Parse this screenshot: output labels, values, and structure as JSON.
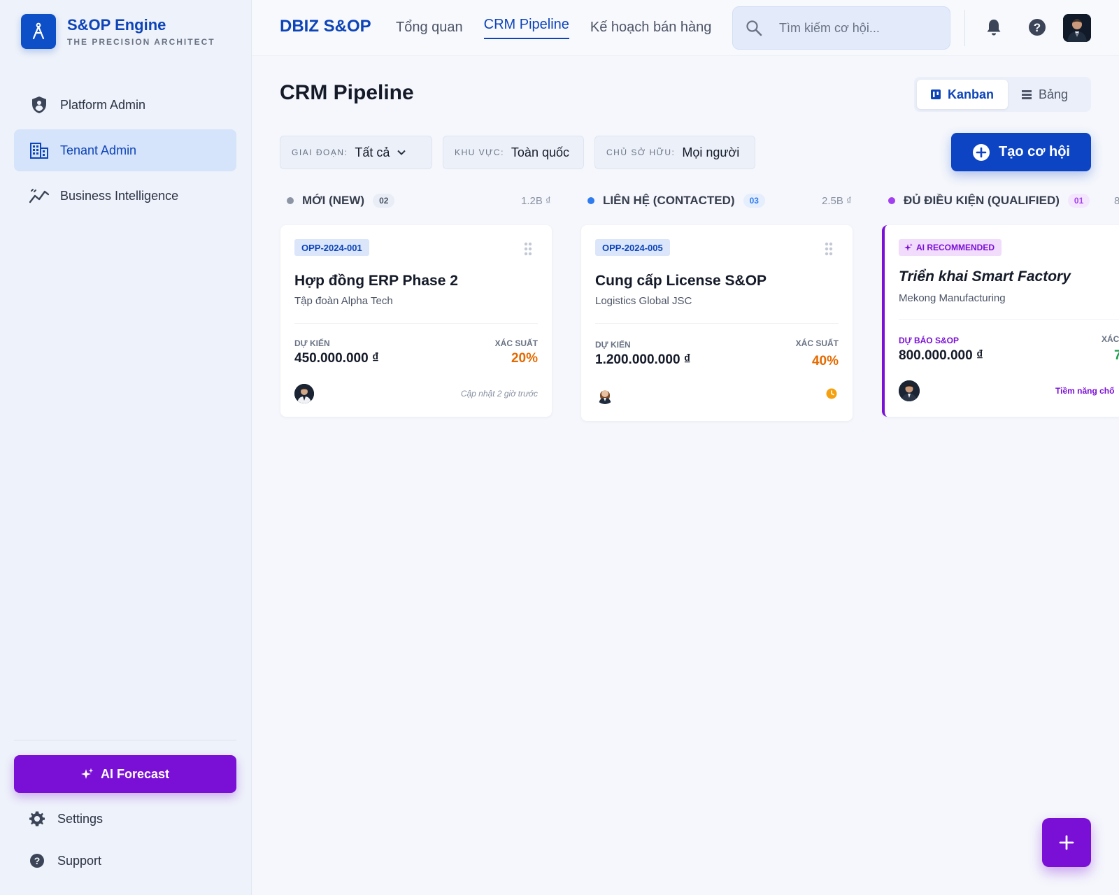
{
  "brand": {
    "title": "S&OP Engine",
    "subtitle": "THE PRECISION ARCHITECT"
  },
  "sidebar": {
    "items": [
      {
        "label": "Platform Admin",
        "icon": "shield-icon",
        "active": false
      },
      {
        "label": "Tenant Admin",
        "icon": "building-icon",
        "active": true
      },
      {
        "label": "Business Intelligence",
        "icon": "analytics-icon",
        "active": false
      }
    ],
    "ai_forecast": "AI Forecast",
    "settings": "Settings",
    "support": "Support"
  },
  "topbar": {
    "app_name": "DBIZ S&OP",
    "tabs": [
      {
        "label": "Tổng quan",
        "active": false
      },
      {
        "label": "CRM Pipeline",
        "active": true
      },
      {
        "label": "Kế hoạch bán hàng",
        "active": false
      }
    ],
    "search_placeholder": "Tìm kiếm cơ hội..."
  },
  "page": {
    "title": "CRM Pipeline",
    "views": {
      "kanban": "Kanban",
      "table": "Bảng",
      "selected": "kanban"
    },
    "filters": [
      {
        "label": "GIAI ĐOẠN:",
        "value": "Tất cả"
      },
      {
        "label": "KHU VỰC:",
        "value": "Toàn quốc"
      },
      {
        "label": "CHỦ SỞ HỮU:",
        "value": "Mọi người"
      }
    ],
    "create_button": "Tạo cơ hội"
  },
  "columns": [
    {
      "title": "MỚI (NEW)",
      "count": "02",
      "total": "1.2B ₫",
      "dot_color": "#8d95a5",
      "card": {
        "tag": "OPP-2024-001",
        "title": "Hợp đồng ERP Phase 2",
        "company": "Tập đoàn Alpha Tech",
        "amount_label": "DỰ KIẾN",
        "amount": "450.000.000 ₫",
        "prob_label": "XÁC SUẤT",
        "prob": "20%",
        "updated": "Cập nhật 2 giờ trước"
      }
    },
    {
      "title": "LIÊN HỆ (CONTACTED)",
      "count": "03",
      "total": "2.5B ₫",
      "dot_color": "#2f7bf0",
      "card": {
        "tag": "OPP-2024-005",
        "title": "Cung cấp License S&OP",
        "company": "Logistics Global JSC",
        "amount_label": "DỰ KIẾN",
        "amount": "1.200.000.000 ₫",
        "prob_label": "XÁC SUẤT",
        "prob": "40%"
      }
    },
    {
      "title": "ĐỦ ĐIỀU KIỆN (QUALIFIED)",
      "count": "01",
      "total": "8",
      "dot_color": "#a23ff0",
      "card": {
        "tag": "AI RECOMMENDED",
        "title": "Triển khai Smart Factory",
        "company": "Mekong Manufacturing",
        "amount_label": "DỰ BÁO S&OP",
        "amount": "800.000.000 ₫",
        "prob_label": "XÁC",
        "prob": "7",
        "note": "Tiềm năng chố"
      }
    }
  ],
  "colors": {
    "primary": "#0d44b8",
    "ai": "#7a0fd6",
    "prob_orange": "#e56a00",
    "prob_green": "#17a34a"
  }
}
